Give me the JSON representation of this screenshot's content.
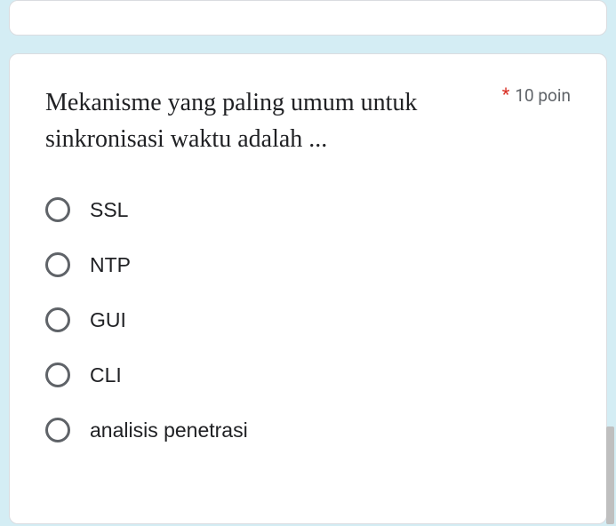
{
  "question": {
    "text": "Mekanisme yang paling umum untuk sinkronisasi waktu adalah ...",
    "required_mark": "*",
    "points_label": "10 poin",
    "options": [
      {
        "label": "SSL"
      },
      {
        "label": "NTP"
      },
      {
        "label": "GUI"
      },
      {
        "label": "CLI"
      },
      {
        "label": "analisis penetrasi"
      }
    ]
  }
}
